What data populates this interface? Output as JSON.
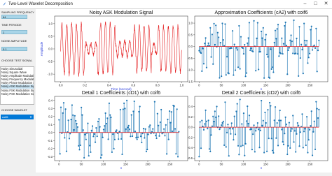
{
  "window": {
    "title": "Two-Level Wavelet Decomposition"
  },
  "sidebar": {
    "sampling_frequency": {
      "label": "SAMPLING FREQUENCY",
      "value": "64"
    },
    "time_period": {
      "label": "TIME PERIODE",
      "value": "1"
    },
    "noise_amplitude": {
      "label": "NOISE AMPLITUDE",
      "value": "0.1"
    },
    "test_signal": {
      "label": "CHOOSE TEST SIGNAL",
      "items": [
        "Noisy Sinusoidal",
        "Noisy Square Wave",
        "Noisy Amplitude Modulation",
        "Noisy Frequency Modulation",
        "Noisy Phase Modulation Sign",
        "Noisy ASK Modulation Sign",
        "Noisy FSK Modulation Signa",
        "Noisy PSK Modulation Signa"
      ],
      "selected": 5
    },
    "wavelet": {
      "label": "CHOOSE WAVELET",
      "value": "coif6"
    }
  },
  "plots": [
    {
      "chart_data": {
        "type": "line",
        "title": "Noisy ASK Modulation Signal",
        "xlabel": "Time (second)",
        "ylabel": "Amplitude",
        "xlim": [
          -0.05,
          1.05
        ],
        "ylim": [
          -1.3,
          1.3
        ],
        "xticks": [
          "0.0",
          "0.2",
          "0.4",
          "0.6",
          "0.8",
          "1.0"
        ],
        "yticks": [
          "-1.0",
          "-0.5",
          "0.0",
          "0.5",
          "1.0"
        ],
        "color": "#e41a1c",
        "series": [
          {
            "segments": [
              {
                "from": 0.0,
                "to": 0.2,
                "amplitude": 1.0
              },
              {
                "from": 0.2,
                "to": 0.3,
                "amplitude": 0.2
              },
              {
                "from": 0.3,
                "to": 0.45,
                "amplitude": 1.0
              },
              {
                "from": 0.45,
                "to": 0.6,
                "amplitude": 0.3
              },
              {
                "from": 0.6,
                "to": 0.75,
                "amplitude": 0.9
              },
              {
                "from": 0.75,
                "to": 0.8,
                "amplitude": 0.2
              },
              {
                "from": 0.8,
                "to": 1.0,
                "amplitude": 0.9
              }
            ],
            "cycles": 25,
            "noise": 0.1
          }
        ]
      }
    },
    {
      "chart_data": {
        "type": "stem",
        "title": "Approximation Coefficients (cA2) with coif6",
        "xlabel": "n",
        "ylabel": "",
        "xlim": [
          -10,
          290
        ],
        "ylim": [
          -1.5,
          1.3
        ],
        "xticks": [
          "0",
          "50",
          "100",
          "150",
          "200",
          "250"
        ],
        "yticks": [
          "-1.5",
          "-1.0",
          "-0.5",
          "0.0",
          "0.5",
          "1.0"
        ],
        "baseline": 0,
        "count": 130,
        "color": "#1f77b4"
      }
    },
    {
      "chart_data": {
        "type": "stem",
        "title": "Detail 1 Coefficients (cD1) with coif6",
        "xlabel": "n",
        "ylabel": "",
        "xlim": [
          -10,
          290
        ],
        "ylim": [
          -0.35,
          0.45
        ],
        "xticks": [
          "0",
          "50",
          "100",
          "150",
          "200",
          "250"
        ],
        "yticks": [
          "-0.3",
          "-0.2",
          "-0.1",
          "0.0",
          "0.1",
          "0.2",
          "0.3",
          "0.4"
        ],
        "baseline": 0,
        "count": 130,
        "color": "#1f77b4"
      }
    },
    {
      "chart_data": {
        "type": "stem",
        "title": "Detail 2 Coefficients (cD2) with coif6",
        "xlabel": "n",
        "ylabel": "",
        "xlim": [
          -10,
          290
        ],
        "ylim": [
          -0.65,
          0.6
        ],
        "xticks": [
          "0",
          "50",
          "100",
          "150",
          "200",
          "250"
        ],
        "yticks": [
          "-0.6",
          "-0.4",
          "-0.2",
          "0.0",
          "0.2",
          "0.4"
        ],
        "baseline": 0,
        "count": 130,
        "color": "#1f77b4"
      }
    }
  ]
}
